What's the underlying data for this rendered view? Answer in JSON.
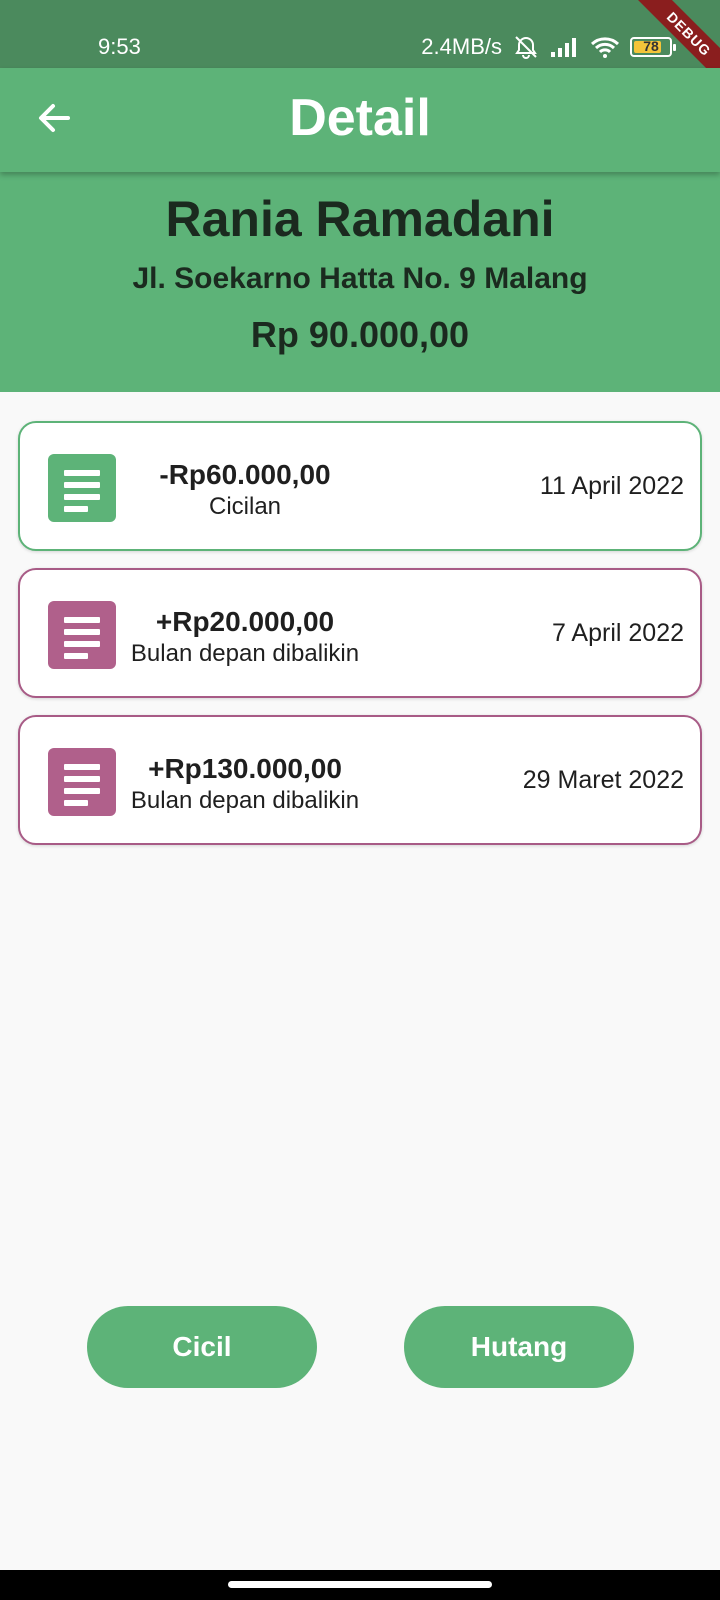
{
  "status_bar": {
    "time": "9:53",
    "net_speed": "2.4MB/s",
    "battery_level": "78",
    "battery_fraction": 0.78,
    "debug_label": "DEBUG"
  },
  "app_bar": {
    "title": "Detail",
    "back_icon": "arrow-left-icon"
  },
  "header": {
    "name": "Rania Ramadani",
    "address": "Jl. Soekarno Hatta No. 9 Malang",
    "total": "Rp 90.000,00"
  },
  "transactions": [
    {
      "amount": "-Rp60.000,00",
      "note": "Cicilan",
      "date": "11 April 2022",
      "kind": "minus",
      "icon": "notes-icon",
      "color": "#5db378"
    },
    {
      "amount": "+Rp20.000,00",
      "note": "Bulan depan dibalikin",
      "date": "7 April 2022",
      "kind": "plus",
      "icon": "notes-icon",
      "color": "#b0608b"
    },
    {
      "amount": "+Rp130.000,00",
      "note": "Bulan depan dibalikin",
      "date": "29 Maret 2022",
      "kind": "plus",
      "icon": "notes-icon",
      "color": "#b0608b"
    }
  ],
  "actions": {
    "cicil_label": "Cicil",
    "hutang_label": "Hutang"
  },
  "colors": {
    "primary": "#5db378",
    "status_bar": "#4b8a5d",
    "debt": "#b0608b"
  }
}
